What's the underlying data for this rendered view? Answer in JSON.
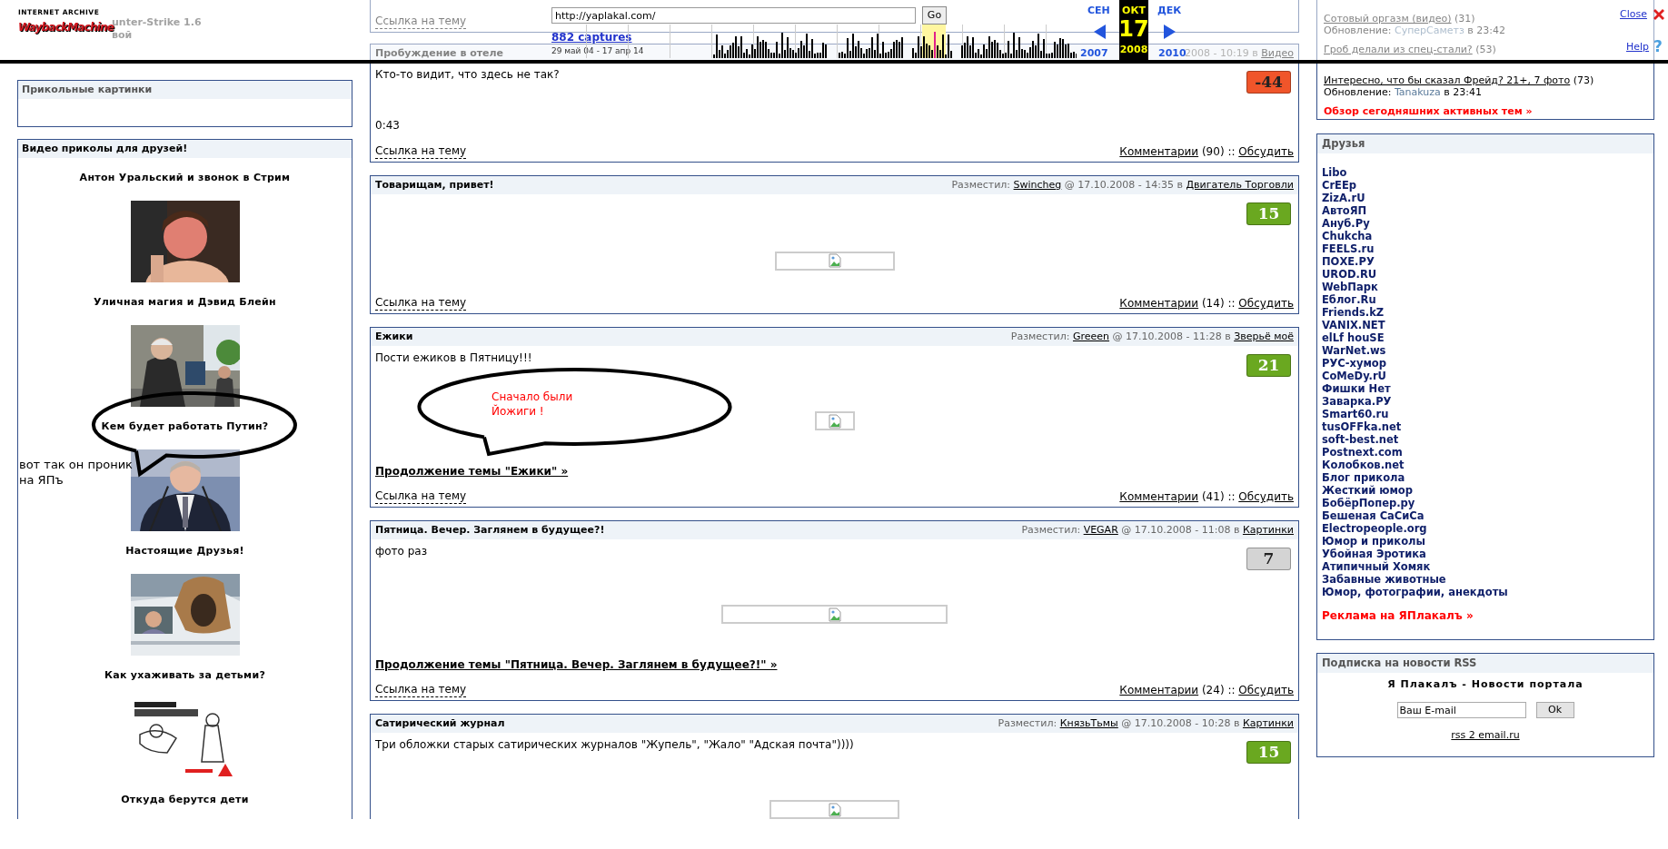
{
  "toolbar": {
    "logo_caption": "INTERNET ARCHIVE",
    "logo_wordmark": "WaybackMachine",
    "url": "http://yaplakal.com/",
    "go": "Go",
    "captures": "882 captures",
    "range": "29 май 04 - 17 апр 14",
    "prev_month": "СЕН",
    "month": "ОКТ",
    "day": "17",
    "year": "2008",
    "next_month": "ДЕК",
    "prev_year": "2007",
    "next_year": "2010",
    "close": "Close",
    "help": "Help",
    "help_icon": "?"
  },
  "left_faded": [
    "unter-Strike 1.6",
    "вой"
  ],
  "funny_pictures": {
    "title": "Прикольные картинки"
  },
  "videos": {
    "title": "Видео приколы для друзей!",
    "items": [
      {
        "title": "Антон Уральский и звонок в Стрим",
        "picture": true
      },
      {
        "title": "Уличная магия и Дэвид Блейн",
        "picture": true
      },
      {
        "title": "Кем будет работать Путин?",
        "picture": true
      },
      {
        "title": "Настоящие Друзья!",
        "picture": true
      },
      {
        "title": "Как ухаживать за детьми?",
        "picture": true
      },
      {
        "title": "Откуда берутся дети",
        "picture": false
      }
    ]
  },
  "posts": [
    {
      "footer": {
        "link": "Ссылка на тему"
      }
    },
    {
      "title": "Пробуждение в отеле",
      "meta": {
        "when": "2008 - 10:19 в",
        "category": "Видео"
      },
      "text": "Кто-то видит, что здесь не так?",
      "rating": {
        "value": "-44",
        "color": "#f0552a"
      },
      "note": "0:43",
      "image": false,
      "footer": {
        "link": "Ссылка на тему",
        "comments": "Комментарии",
        "count": "(90) ::",
        "discuss": "Обсудить"
      }
    },
    {
      "title": "Товарищам, привет!",
      "meta": {
        "label": "Разместил:",
        "author": "Swincheg",
        "when": "@ 17.10.2008 - 14:35 в",
        "category": "Двигатель Торговли"
      },
      "rating": {
        "value": "15",
        "color": "#6aa820"
      },
      "image": true,
      "footer": {
        "link": "Ссылка на тему",
        "comments": "Комментарии",
        "count": "(14) ::",
        "discuss": "Обсудить"
      }
    },
    {
      "title": "Ежики",
      "meta": {
        "label": "Разместил:",
        "author": "Greeen",
        "when": "@ 17.10.2008 - 11:28 в",
        "category": "Зверьё моё"
      },
      "text": "Пости ежиков в Пятницу!!!",
      "rating": {
        "value": "21",
        "color": "#6aa820"
      },
      "image": true,
      "continue_link": "Продолжение темы \"Ежики\" »",
      "footer": {
        "link": "Ссылка на тему",
        "comments": "Комментарии",
        "count": "(41) ::",
        "discuss": "Обсудить"
      }
    },
    {
      "title": "Пятница. Вечер. Заглянем в будущее?!",
      "meta": {
        "label": "Разместил:",
        "author": "VEGAR",
        "when": "@ 17.10.2008 - 11:08 в",
        "category": "Картинки"
      },
      "text": "фото раз",
      "rating": {
        "value": "7",
        "color": "#d4d4d4"
      },
      "image": true,
      "continue_link": "Продолжение темы \"Пятница. Вечер. Заглянем в будущее?!\" »",
      "footer": {
        "link": "Ссылка на тему",
        "comments": "Комментарии",
        "count": "(24) ::",
        "discuss": "Обсудить"
      }
    },
    {
      "title": "Сатирический журнал",
      "meta": {
        "label": "Разместил:",
        "author": "КнязьТьмы",
        "when": "@ 17.10.2008 - 10:28 в",
        "category": "Картинки"
      },
      "text": "Три обложки старых сатирических журналов \"Жупель\", \"Жало\" \"Адская почта\"))))",
      "rating": {
        "value": "15",
        "color": "#6aa820"
      },
      "image": true
    }
  ],
  "active_topics": {
    "items": [
      {
        "title": "Сотовый оргазм (видео)",
        "count": "(31)",
        "updated": "Обновление:",
        "user": "СуперСаметз",
        "time": "в 23:42"
      },
      {
        "title": "Гроб делали из спец-стали?",
        "count": "(53)"
      },
      {
        "title": "Интересно, что бы сказал Фрейд? 21+, 7 фото",
        "count": "(73)",
        "updated": "Обновление:",
        "user": "Tanakuza",
        "time": "в 23:41"
      }
    ],
    "overview_link": "Обзор сегодняшних активных тем »"
  },
  "friends": {
    "title": "Друзья",
    "links": [
      "Libo",
      "CrEEp",
      "ZizA.rU",
      "АвтоЯП",
      "Ануб.Ру",
      "Chukcha",
      "FEELS.ru",
      "ПОХЕ.РУ",
      "UROD.RU",
      "WebПарк",
      "Еблог.Ru",
      "Friends.kZ",
      "VANIX.NET",
      "elLf houSE",
      "WarNet.ws",
      "РУС-хумор",
      "CoMeDy.rU",
      "Фишки Нет",
      "Заварка.РУ",
      "Smart60.ru",
      "tusOFFka.net",
      "soft-best.net",
      "Postnext.com",
      "Колобков.net",
      "Блог прикола",
      "Жесткий юмор",
      "БобёрПопер.ру",
      "Бешеная СаСиСа",
      "Electropeople.org",
      "Юмор и приколы",
      "Убойная Эротика",
      "Атипичный Хомяк",
      "Забавные животные",
      "Юмор, фотографии, анекдоты"
    ],
    "ad_link": "Реклама на ЯПлакалъ »"
  },
  "rss": {
    "title": "Подписка на новости RSS",
    "subtitle": "Я Плакалъ - Новости портала",
    "email": "Ваш E-mail",
    "button": "Ok",
    "link": "rss 2 email.ru"
  },
  "annotations": [
    {
      "text": "вот так он проник\nна ЯПъ",
      "color": "#000000"
    },
    {
      "text": "Сначало были\nЙожиги !",
      "color": "#ff0000"
    }
  ]
}
